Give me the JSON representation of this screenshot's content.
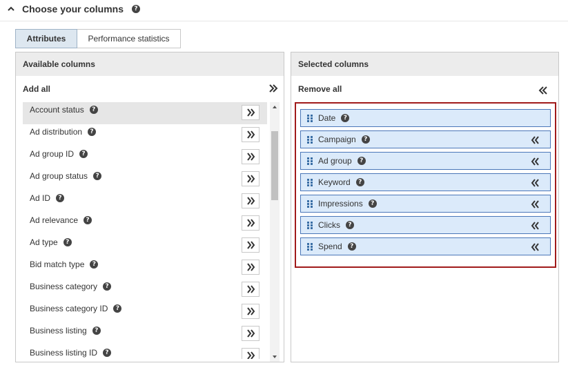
{
  "header": {
    "title": "Choose your columns",
    "help": "?"
  },
  "tabs": [
    {
      "label": "Attributes",
      "active": true
    },
    {
      "label": "Performance statistics",
      "active": false
    }
  ],
  "available": {
    "title": "Available columns",
    "add_all": "Add all",
    "items": [
      {
        "label": "Account status",
        "highlight": true
      },
      {
        "label": "Ad distribution"
      },
      {
        "label": "Ad group ID"
      },
      {
        "label": "Ad group status"
      },
      {
        "label": "Ad ID"
      },
      {
        "label": "Ad relevance"
      },
      {
        "label": "Ad type"
      },
      {
        "label": "Bid match type"
      },
      {
        "label": "Business category"
      },
      {
        "label": "Business category ID"
      },
      {
        "label": "Business listing"
      },
      {
        "label": "Business listing ID"
      }
    ]
  },
  "selected": {
    "title": "Selected columns",
    "remove_all": "Remove all",
    "items": [
      {
        "label": "Date",
        "removable": false
      },
      {
        "label": "Campaign",
        "removable": true
      },
      {
        "label": "Ad group",
        "removable": true
      },
      {
        "label": "Keyword",
        "removable": true
      },
      {
        "label": "Impressions",
        "removable": true
      },
      {
        "label": "Clicks",
        "removable": true
      },
      {
        "label": "Spend",
        "removable": true
      }
    ]
  },
  "colors": {
    "accent_blue": "#4a76b8",
    "selected_fill": "#dbeafa",
    "highlight_border": "#a01a1a"
  },
  "icons": {
    "collapse": "chevron-up-icon",
    "add": "double-chevron-right-icon",
    "remove": "double-chevron-left-icon",
    "drag": "drag-handle-icon",
    "help": "help-icon"
  }
}
